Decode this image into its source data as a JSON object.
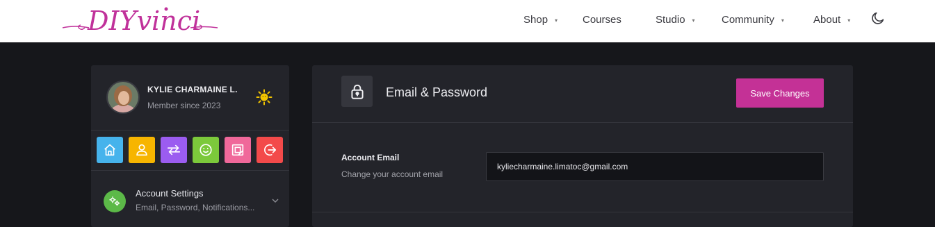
{
  "header": {
    "logo_text": "DIYvinci",
    "nav": [
      {
        "label": "Shop",
        "has_dropdown": true
      },
      {
        "label": "Courses",
        "has_dropdown": false
      },
      {
        "label": "Studio",
        "has_dropdown": true
      },
      {
        "label": "Community",
        "has_dropdown": true
      },
      {
        "label": "About",
        "has_dropdown": true
      }
    ],
    "theme_icon": "moon-icon"
  },
  "sidebar": {
    "user_name": "KYLIE CHARMAINE L.",
    "member_since": "Member since 2023",
    "status_icon": "sun-icon",
    "quick_links": [
      {
        "icon": "home-icon",
        "color": "#46b3ec"
      },
      {
        "icon": "user-icon",
        "color": "#f7b500"
      },
      {
        "icon": "swap-arrows-icon",
        "color": "#9b5cf0"
      },
      {
        "icon": "smile-icon",
        "color": "#7cc93b"
      },
      {
        "icon": "gallery-icon",
        "color": "#f0689a"
      },
      {
        "icon": "logout-icon",
        "color": "#f34a4a"
      }
    ],
    "settings": {
      "title": "Account Settings",
      "subtitle": "Email, Password, Notifications...",
      "icon": "gears-icon",
      "icon_color": "#5cb948"
    }
  },
  "panel": {
    "title": "Email & Password",
    "save_label": "Save Changes",
    "accent": "#c43196",
    "email": {
      "label": "Account Email",
      "description": "Change your account email",
      "value": "kyliecharmaine.limatoc@gmail.com"
    }
  }
}
